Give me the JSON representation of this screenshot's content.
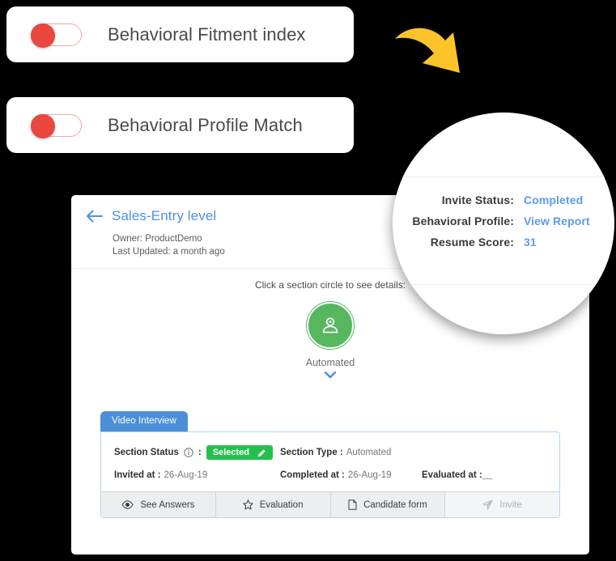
{
  "toggles": [
    {
      "label": "Behavioral Fitment index",
      "state": "off",
      "knob_color": "#e9473f",
      "icon": "toggle-switch-icon"
    },
    {
      "label": "Behavioral Profile Match",
      "state": "off",
      "knob_color": "#e9473f",
      "icon": "toggle-switch-icon"
    }
  ],
  "arrow": {
    "icon": "curved-arrow-icon",
    "color": "#fdc32a",
    "direction": "down-right"
  },
  "app_card": {
    "back_icon": "back-arrow-icon",
    "title": "Sales-Entry level",
    "owner": "Owner: ProductDemo",
    "last_updated": "Last Updated: a month ago",
    "details": [
      {
        "label": "Invite Status:",
        "value": "Completed"
      },
      {
        "label": "Behavioral Profile:",
        "value": "View Report"
      },
      {
        "label": "Resume Score:",
        "value": "31"
      }
    ],
    "section": {
      "hint": "Click a section circle to see details:",
      "circle_icon": "webcam-person-icon",
      "circle_color": "#56b75f",
      "name": "Automated",
      "chevron_icon": "chevron-down-icon",
      "chevron_color": "#4d90e8"
    },
    "tab": {
      "label": "Video Interview",
      "color": "#4b8fd8"
    },
    "fields": {
      "section_status_label": "Section Status",
      "info_icon": "info-circle-icon",
      "colon": ":",
      "status_badge": "Selected",
      "status_badge_color": "#24c04e",
      "edit_icon": "pencil-icon",
      "section_type_label": "Section Type :",
      "section_type_value": "Automated",
      "invited_at_label": "Invited at :",
      "invited_at_value": "26-Aug-19",
      "completed_at_label": "Completed at :",
      "completed_at_value": "26-Aug-19",
      "evaluated_at_label": "Evaluated at :",
      "evaluated_at_value": "__"
    },
    "buttons": [
      {
        "label": "See Answers",
        "icon": "eye-icon",
        "disabled": false
      },
      {
        "label": "Evaluation",
        "icon": "star-icon",
        "disabled": false
      },
      {
        "label": "Candidate form",
        "icon": "document-icon",
        "disabled": false
      },
      {
        "label": "Invite",
        "icon": "paper-plane-icon",
        "disabled": true
      }
    ]
  },
  "magnifier": {
    "rows": [
      {
        "label": "Invite Status:",
        "value": "Completed"
      },
      {
        "label": "Behavioral Profile:",
        "value": "View Report"
      },
      {
        "label": "Resume Score:",
        "value": "31"
      }
    ],
    "fragment_text": "ils:"
  }
}
